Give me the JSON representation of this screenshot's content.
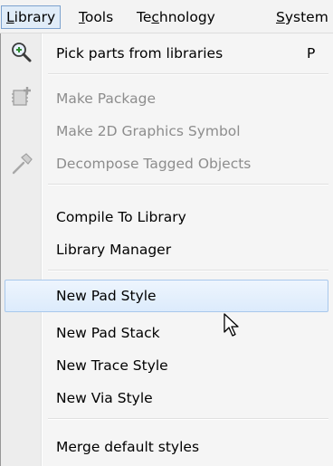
{
  "menubar": {
    "items": [
      {
        "label": "Library",
        "underline": "L"
      },
      {
        "label": "Tools",
        "underline": "T"
      },
      {
        "label": "Technology",
        "underline": "c"
      },
      {
        "label": "System",
        "underline": "S"
      }
    ]
  },
  "menu": {
    "items": [
      {
        "label": "Pick parts from libraries",
        "shortcut": "P",
        "enabled": true,
        "icon": "magnifier-parts-icon"
      },
      {
        "label": "Make Package",
        "enabled": false,
        "icon": "package-add-icon"
      },
      {
        "label": "Make 2D Graphics Symbol",
        "enabled": false
      },
      {
        "label": "Decompose Tagged Objects",
        "enabled": false,
        "icon": "hammer-icon"
      },
      {
        "label": "Compile To Library",
        "enabled": true
      },
      {
        "label": "Library Manager",
        "enabled": true
      },
      {
        "label": "New Pad Style",
        "enabled": true,
        "highlighted": true
      },
      {
        "label": "New Pad Stack",
        "enabled": true
      },
      {
        "label": "New Trace Style",
        "enabled": true
      },
      {
        "label": "New Via Style",
        "enabled": true
      },
      {
        "label": "Merge default styles",
        "enabled": true
      }
    ]
  },
  "colors": {
    "highlight": "#dcebfc",
    "highlight_border": "#a8c8ec",
    "disabled_text": "#8d8d8d",
    "menubar_active": "#e0ecf8"
  }
}
